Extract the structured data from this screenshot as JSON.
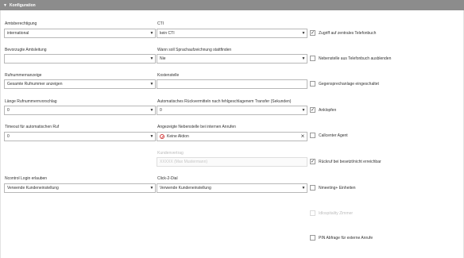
{
  "header": {
    "title": "Konfiguration"
  },
  "col1": {
    "amtsberechtigung": {
      "label": "Amtsberechtigung",
      "value": "international"
    },
    "bevorzugte": {
      "label": "Bevorzugte Amtsleitung",
      "value": ""
    },
    "rufnummernanzeige": {
      "label": "Rufnummernanzeige",
      "value": "Gesamte Rufnummer anzeigen"
    },
    "laenge": {
      "label": "Länge Rufnummernvorschlag",
      "value": "0"
    },
    "timeout": {
      "label": "Timeout für automatischen Ruf",
      "value": "0"
    },
    "ncontrol": {
      "label": "Ncontrol Login erlauben",
      "value": "Verwende Kundeneinstellung"
    }
  },
  "col2": {
    "cti": {
      "label": "CTI",
      "value": "kein CTI"
    },
    "sprachaufzeichnung": {
      "label": "Wann soll Sprachaufzeichnung stattfinden",
      "value": "Nie"
    },
    "kostenstelle": {
      "label": "Kostenstelle",
      "value": ""
    },
    "rueckvermitteln": {
      "label": "Automatisches Rückvermitteln nach fehlgeschlagenem Transfer (Sekunden)",
      "value": "0"
    },
    "nebenstelle": {
      "label": "Angezeigte Nebenstelle bei internen Anrufen",
      "value": "Keine Aktion"
    },
    "kundenvertrag": {
      "label": "Kundenvertrag",
      "value": "XXXXX (Max Mustermann)"
    },
    "click2dial": {
      "label": "Click-2-Dial",
      "value": "Verwende Kundeneinstellung"
    }
  },
  "checks": [
    {
      "label": "Zugriff auf zentrales Telefonbuch",
      "checked": true,
      "disabled": false
    },
    {
      "label": "Nebenstelle aus Telefonbuch ausblenden",
      "checked": false,
      "disabled": false
    },
    {
      "label": "Gegensprechanlage eingeschaltet",
      "checked": false,
      "disabled": false
    },
    {
      "label": "Anklopfen",
      "checked": true,
      "disabled": false
    },
    {
      "label": "Callcenter Agent",
      "checked": false,
      "disabled": false
    },
    {
      "label": "Rückruf bei besetzt/nicht erreichbar",
      "checked": true,
      "disabled": false
    },
    {
      "label": "Nmeeting+ Einheiten",
      "checked": false,
      "disabled": false
    },
    {
      "label": "Idlospitality Zimmer",
      "checked": false,
      "disabled": true
    },
    {
      "label": "PIN Abfrage für externe Anrufe",
      "checked": false,
      "disabled": false
    }
  ],
  "icons": {
    "caret": "▼",
    "arrow": "▼",
    "check": "✓",
    "clear": "×"
  }
}
